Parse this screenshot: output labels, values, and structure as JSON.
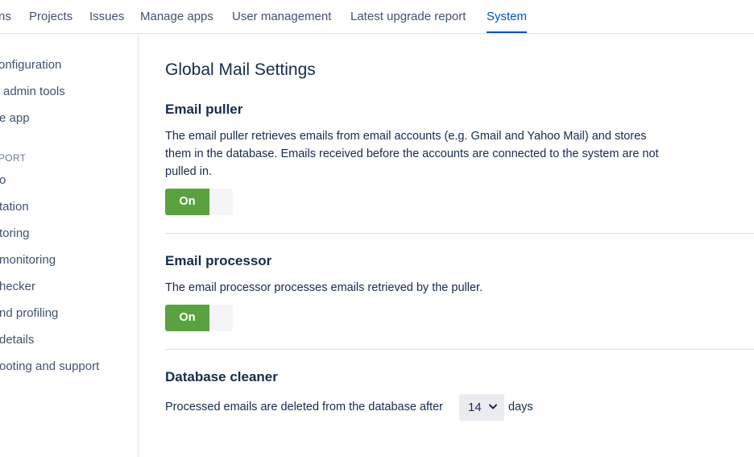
{
  "topnav": {
    "tabs": [
      {
        "label": "ns"
      },
      {
        "label": "Projects"
      },
      {
        "label": "Issues"
      },
      {
        "label": "Manage apps"
      },
      {
        "label": "User management"
      },
      {
        "label": "Latest upgrade report"
      },
      {
        "label": "System"
      }
    ],
    "active_tab": "System"
  },
  "sidebar": {
    "items": [
      {
        "label": "onfiguration"
      },
      {
        "label": "admin tools"
      },
      {
        "label": "e app"
      }
    ],
    "heading": "PORT",
    "support_items": [
      {
        "label": "o"
      },
      {
        "label": "tation"
      },
      {
        "label": "toring"
      },
      {
        "label": "monitoring"
      },
      {
        "label": "hecker"
      },
      {
        "label": "nd profiling"
      },
      {
        "label": "details"
      },
      {
        "label": "ooting and support"
      }
    ]
  },
  "main": {
    "title": "Global Mail Settings",
    "email_puller": {
      "title": "Email puller",
      "description_lines": [
        "The email puller retrieves emails from email accounts (e.g. Gmail and Yahoo Mail) and stores",
        "them in the database. Emails received before the accounts are connected to the system are not",
        "pulled in."
      ],
      "toggle_label": "On"
    },
    "email_processor": {
      "title": "Email processor",
      "description": "The email processor processes emails retrieved by the puller.",
      "toggle_label": "On"
    },
    "database_cleaner": {
      "title": "Database cleaner",
      "text_before": "Processed emails are deleted from the database after",
      "days_value": "14",
      "text_after": "days"
    }
  },
  "colors": {
    "accent": "#0052cc",
    "toggle_on": "#5aa23f",
    "text_primary": "#172b4d",
    "text_secondary": "#42526e"
  }
}
